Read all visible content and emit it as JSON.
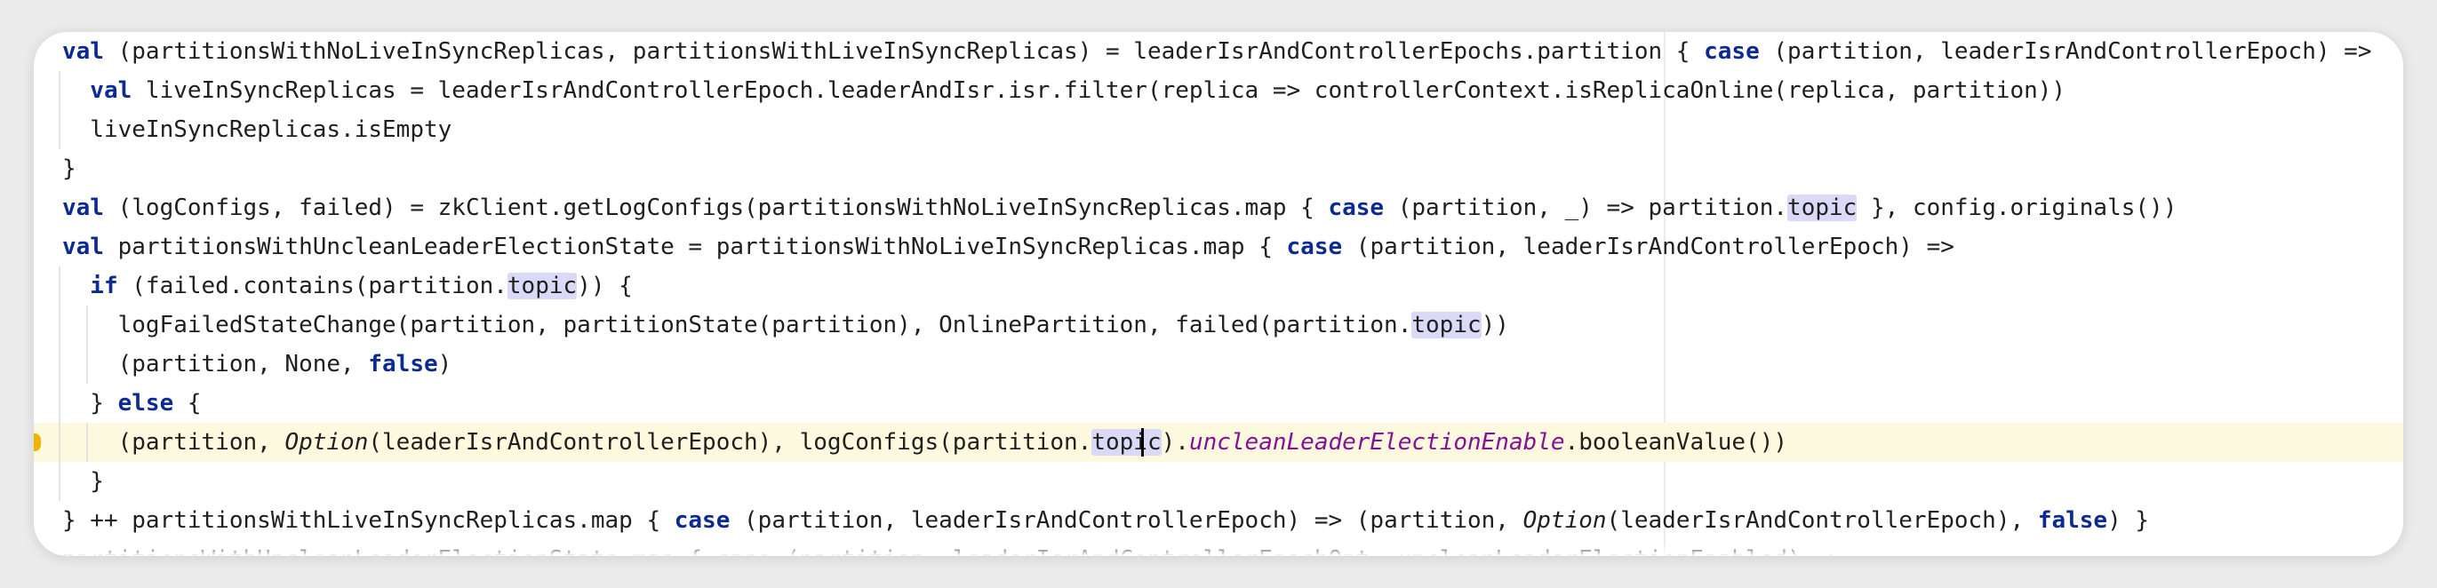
{
  "editor": {
    "lines": [
      {
        "indent": 0,
        "tokens": [
          {
            "t": "val",
            "c": "kw"
          },
          {
            "t": " (partitionsWithNoLiveInSyncReplicas, partitionsWithLiveInSyncReplicas) = leaderIsrAndControllerEpochs.partition { "
          },
          {
            "t": "case",
            "c": "kw"
          },
          {
            "t": " (partition, leaderIsrAndControllerEpoch) =>"
          }
        ]
      },
      {
        "indent": 1,
        "tokens": [
          {
            "t": "val",
            "c": "kw"
          },
          {
            "t": " liveInSyncReplicas = leaderIsrAndControllerEpoch.leaderAndIsr.isr.filter(replica => controllerContext.isReplicaOnline(replica, partition))"
          }
        ]
      },
      {
        "indent": 1,
        "tokens": [
          {
            "t": "liveInSyncReplicas.isEmpty"
          }
        ]
      },
      {
        "indent": 0,
        "tokens": [
          {
            "t": "}"
          }
        ]
      },
      {
        "indent": 0,
        "tokens": [
          {
            "t": "val",
            "c": "kw"
          },
          {
            "t": " (logConfigs, failed) = zkClient.getLogConfigs(partitionsWithNoLiveInSyncReplicas.map { "
          },
          {
            "t": "case",
            "c": "kw"
          },
          {
            "t": " (partition, _) => partition."
          },
          {
            "t": "topic",
            "c": "hl"
          },
          {
            "t": " }, config.originals())"
          }
        ]
      },
      {
        "indent": 0,
        "tokens": [
          {
            "t": "val",
            "c": "kw"
          },
          {
            "t": " partitionsWithUncleanLeaderElectionState = partitionsWithNoLiveInSyncReplicas.map { "
          },
          {
            "t": "case",
            "c": "kw"
          },
          {
            "t": " (partition, leaderIsrAndControllerEpoch) =>"
          }
        ]
      },
      {
        "indent": 1,
        "tokens": [
          {
            "t": "if",
            "c": "kw"
          },
          {
            "t": " (failed.contains(partition."
          },
          {
            "t": "topic",
            "c": "hl"
          },
          {
            "t": ")) {"
          }
        ]
      },
      {
        "indent": 2,
        "tokens": [
          {
            "t": "logFailedStateChange(partition, partitionState(partition), OnlinePartition, failed(partition."
          },
          {
            "t": "topic",
            "c": "hl"
          },
          {
            "t": "))"
          }
        ]
      },
      {
        "indent": 2,
        "tokens": [
          {
            "t": "(partition, None, "
          },
          {
            "t": "false",
            "c": "kw"
          },
          {
            "t": ")"
          }
        ]
      },
      {
        "indent": 1,
        "tokens": [
          {
            "t": "} "
          },
          {
            "t": "else",
            "c": "kw"
          },
          {
            "t": " {"
          }
        ]
      },
      {
        "indent": 2,
        "current": true,
        "tokens": [
          {
            "t": "(partition, "
          },
          {
            "t": "Option",
            "c": "it"
          },
          {
            "t": "(leaderIsrAndControllerEpoch), logConfigs(partition."
          },
          {
            "t": "topic",
            "c": "hl"
          },
          {
            "t": ")."
          },
          {
            "t": "uncleanLeaderElectionEnable",
            "c": "purple"
          },
          {
            "t": ".booleanValue())"
          }
        ]
      },
      {
        "indent": 1,
        "tokens": [
          {
            "t": "}"
          }
        ]
      },
      {
        "indent": 0,
        "tokens": [
          {
            "t": "} ++ partitionsWithLiveInSyncReplicas.map { "
          },
          {
            "t": "case",
            "c": "kw"
          },
          {
            "t": " (partition, leaderIsrAndControllerEpoch) => (partition, "
          },
          {
            "t": "Option",
            "c": "it"
          },
          {
            "t": "(leaderIsrAndControllerEpoch), "
          },
          {
            "t": "false",
            "c": "kw"
          },
          {
            "t": ") }"
          }
        ]
      },
      {
        "indent": 0,
        "tokens": [
          {
            "t": "partitionsWithUncleanLeaderElectionState.map { "
          },
          {
            "t": "case",
            "c": "kw"
          },
          {
            "t": " (partition, leaderIsrAndControllerEpochOpt, uncleanLeaderElectionEnabled) =>"
          }
        ]
      }
    ]
  }
}
